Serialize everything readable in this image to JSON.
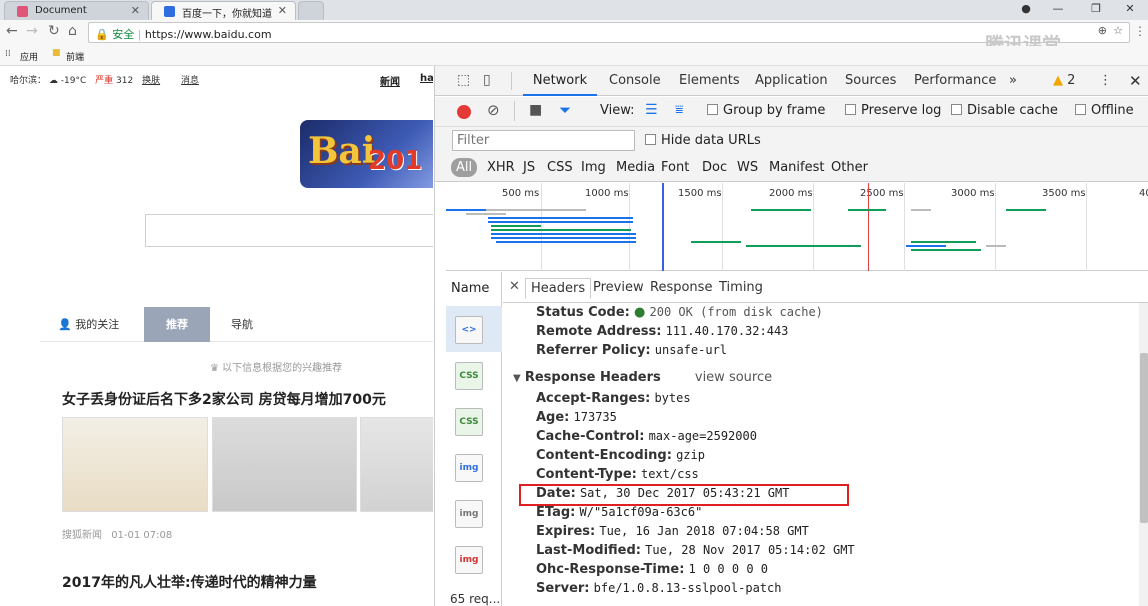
{
  "browser": {
    "tabs": [
      {
        "title": "Document",
        "active": false
      },
      {
        "title": "百度一下，你就知道",
        "active": true
      }
    ],
    "address": {
      "secure_label": "安全",
      "url": "https://www.baidu.com"
    },
    "bookmarks": [
      {
        "label": "应用"
      },
      {
        "label": "前端"
      }
    ],
    "watermark": "腾讯课堂"
  },
  "baidu": {
    "top_bar": {
      "city": "哈尔滨：",
      "temp": "-19°C",
      "aqi_label": "严重",
      "aqi_value": "312",
      "switch": "换肤",
      "msg": "消息",
      "nav1": "新闻",
      "nav2": "ha"
    },
    "feed_tabs": [
      {
        "label": "我的关注",
        "active": false
      },
      {
        "label": "推荐",
        "active": true
      },
      {
        "label": "导航",
        "active": false
      }
    ],
    "recommend_hint": "以下信息根据您的兴趣推荐",
    "headline1": "女子丢身份证后名下多2家公司 房贷每月增加700元",
    "source1": "搜狐新闻",
    "time1": "01-01 07:08",
    "headline2": "2017年的凡人壮举:传递时代的精神力量"
  },
  "devtools": {
    "tabs": [
      {
        "label": "Network",
        "active": true
      },
      {
        "label": "Console"
      },
      {
        "label": "Elements"
      },
      {
        "label": "Application"
      },
      {
        "label": "Sources"
      },
      {
        "label": "Performance"
      }
    ],
    "more": "»",
    "warning_count": "2",
    "view_label": "View:",
    "group_by_frame": "Group by frame",
    "preserve_log": "Preserve log",
    "disable_cache": "Disable cache",
    "offline": "Offline",
    "filter_placeholder": "Filter",
    "hide_data_urls": "Hide data URLs",
    "types": [
      "All",
      "XHR",
      "JS",
      "CSS",
      "Img",
      "Media",
      "Font",
      "Doc",
      "WS",
      "Manifest",
      "Other"
    ],
    "timeline_ticks": [
      "500 ms",
      "1000 ms",
      "1500 ms",
      "2000 ms",
      "2500 ms",
      "3000 ms",
      "3500 ms",
      "40"
    ],
    "name_header": "Name",
    "request_count": "65 req...",
    "file_icons": [
      "<>",
      "CSS",
      "CSS",
      "img",
      "img",
      "img"
    ],
    "detail_tabs": [
      {
        "label": "Headers",
        "active": true
      },
      {
        "label": "Preview"
      },
      {
        "label": "Response"
      },
      {
        "label": "Timing"
      }
    ],
    "general": [
      {
        "key": "Status Code:",
        "value": "200 OK (from disk cache)"
      },
      {
        "key": "Remote Address:",
        "value": "111.40.170.32:443"
      },
      {
        "key": "Referrer Policy:",
        "value": "unsafe-url"
      }
    ],
    "response_headers_title": "Response Headers",
    "view_source": "view source",
    "response_headers": [
      {
        "key": "Accept-Ranges:",
        "value": "bytes"
      },
      {
        "key": "Age:",
        "value": "173735"
      },
      {
        "key": "Cache-Control:",
        "value": "max-age=2592000"
      },
      {
        "key": "Content-Encoding:",
        "value": "gzip"
      },
      {
        "key": "Content-Type:",
        "value": "text/css"
      },
      {
        "key": "Date:",
        "value": "Sat, 30 Dec 2017 05:43:21 GMT"
      },
      {
        "key": "ETag:",
        "value": "W/\"5a1cf09a-63c6\""
      },
      {
        "key": "Expires:",
        "value": "Tue, 16 Jan 2018 07:04:58 GMT"
      },
      {
        "key": "Last-Modified:",
        "value": "Tue, 28 Nov 2017 05:14:02 GMT"
      },
      {
        "key": "Ohc-Response-Time:",
        "value": "1 0 0 0 0 0"
      },
      {
        "key": "Server:",
        "value": "bfe/1.0.8.13-sslpool-patch"
      }
    ],
    "colors": {
      "accent": "#1a73e8",
      "record": "#e53935",
      "status_ok": "#2e7d32",
      "highlight": "#e02020"
    }
  }
}
